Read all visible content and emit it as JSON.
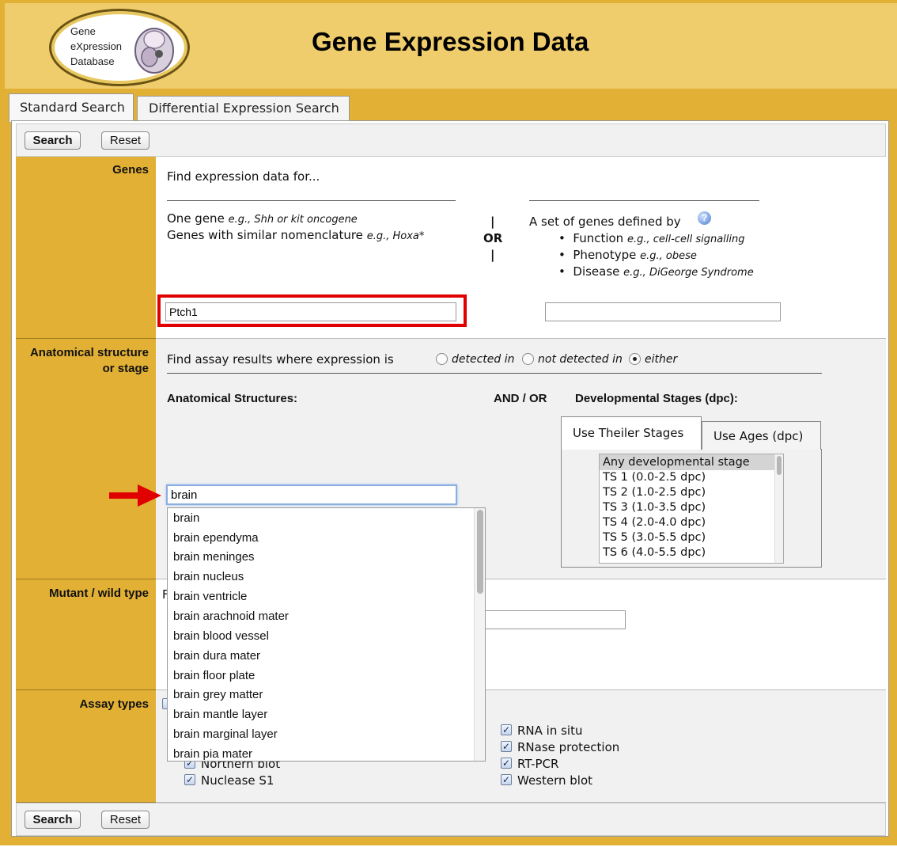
{
  "header": {
    "logo": {
      "line1": "Gene",
      "line2": "eXpression",
      "line3": "Database"
    },
    "title": "Gene Expression Data"
  },
  "tabs": [
    {
      "label": "Standard Search",
      "active": true
    },
    {
      "label": "Differential Expression Search",
      "active": false
    }
  ],
  "toolbar": {
    "search_label": "Search",
    "reset_label": "Reset"
  },
  "genes": {
    "label": "Genes",
    "intro": "Find expression data for...",
    "one_gene": "One gene",
    "one_gene_eg": "e.g., Shh or kit oncogene",
    "similar": "Genes with similar nomenclature",
    "similar_eg": "e.g., Hoxa*",
    "or_top": "|",
    "or_word": "OR",
    "or_bottom": "|",
    "set_title": "A set of genes defined by",
    "bullets": [
      {
        "name": "Function",
        "eg": "e.g., cell-cell signalling"
      },
      {
        "name": "Phenotype",
        "eg": "e.g., obese"
      },
      {
        "name": "Disease",
        "eg": "e.g., DiGeorge Syndrome"
      }
    ],
    "gene_input_value": "Ptch1",
    "set_input_value": ""
  },
  "anatomy": {
    "label_line1": "Anatomical structure",
    "label_line2": "or stage",
    "prompt": "Find assay results where expression is",
    "radio_detected": "detected in",
    "radio_not_detected": "not detected in",
    "radio_either": "either",
    "selected": "either",
    "structures_heading": "Anatomical Structures:",
    "andor": "AND / OR",
    "stages_heading": "Developmental Stages (dpc):",
    "stage_tab_theiler": "Use Theiler Stages",
    "stage_tab_ages": "Use Ages (dpc)",
    "structure_input_value": "brain",
    "autocomplete": [
      "brain",
      "brain ependyma",
      "brain meninges",
      "brain nucleus",
      "brain ventricle",
      "brain arachnoid mater",
      "brain blood vessel",
      "brain dura mater",
      "brain floor plate",
      "brain grey matter",
      "brain mantle layer",
      "brain marginal layer",
      "brain pia mater"
    ],
    "stages": [
      "Any developmental stage",
      "TS 1 (0.0-2.5 dpc)",
      "TS 2 (1.0-2.5 dpc)",
      "TS 3 (1.0-3.5 dpc)",
      "TS 4 (2.0-4.0 dpc)",
      "TS 5 (3.0-5.5 dpc)",
      "TS 6 (4.0-5.5 dpc)"
    ]
  },
  "mutant": {
    "label": "Mutant / wild type",
    "partial_text": "F"
  },
  "assays": {
    "label": "Assay types",
    "left": [
      "Northern blot",
      "Nuclease S1"
    ],
    "right": [
      "RNA in situ",
      "RNase protection",
      "RT-PCR",
      "Western blot"
    ]
  },
  "colors": {
    "accent": "#e2b034",
    "header": "#f0cd6c",
    "highlight": "#e00000"
  }
}
